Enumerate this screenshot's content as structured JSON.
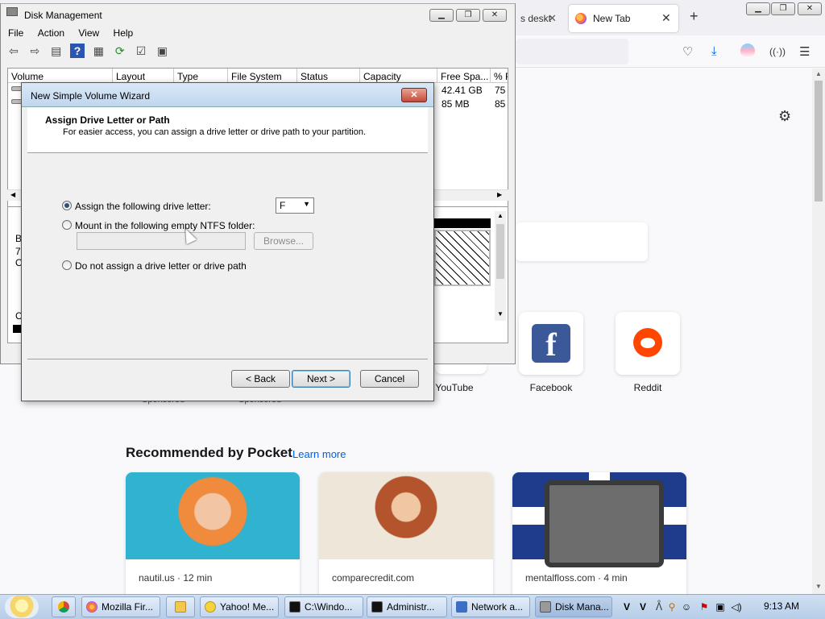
{
  "firefox": {
    "tabs": {
      "partial_label": "s deskt",
      "active_label": "New Tab"
    },
    "shortcuts": [
      {
        "label": "YouTube"
      },
      {
        "label": "Facebook"
      },
      {
        "label": "Reddit"
      }
    ],
    "sponsored_label": "Sponsored",
    "pocket": {
      "heading": "Recommended by Pocket",
      "learn_more": "Learn more",
      "cards": [
        {
          "source": "nautil.us · 12 min"
        },
        {
          "source": "comparecredit.com"
        },
        {
          "source": "mentalfloss.com · 4 min"
        }
      ]
    }
  },
  "disk_management": {
    "title": "Disk Management",
    "menu": [
      "File",
      "Action",
      "View",
      "Help"
    ],
    "columns": [
      "Volume",
      "Layout",
      "Type",
      "File System",
      "Status",
      "Capacity",
      "Free Spa...",
      "% F"
    ],
    "rows": [
      {
        "free": "42.41 GB",
        "pct": "75"
      },
      {
        "free": "85 MB",
        "pct": "85"
      }
    ],
    "left_edge_glyphs": [
      "B",
      "7:",
      "O",
      "C"
    ]
  },
  "wizard": {
    "title": "New Simple Volume Wizard",
    "heading": "Assign Drive Letter or Path",
    "subheading": "For easier access, you can assign a drive letter or drive path to your partition.",
    "options": {
      "assign_letter": "Assign the following drive letter:",
      "mount_folder": "Mount in the following empty NTFS folder:",
      "no_assign": "Do not assign a drive letter or drive path"
    },
    "selected_drive": "F",
    "browse": "Browse...",
    "buttons": {
      "back": "< Back",
      "next": "Next >",
      "cancel": "Cancel"
    }
  },
  "taskbar": {
    "items": [
      {
        "label": "Mozilla Fir..."
      },
      {
        "label": "Yahoo! Me..."
      },
      {
        "label": "C:\\Windo..."
      },
      {
        "label": "Administr..."
      },
      {
        "label": "Network a..."
      },
      {
        "label": "Disk Mana..."
      }
    ],
    "clock": "9:13 AM"
  },
  "colors": {
    "firefox_accent": "#0061e0",
    "facebook": "#3b5998",
    "reddit": "#ff4500",
    "taskbar": "#b7cde8"
  }
}
